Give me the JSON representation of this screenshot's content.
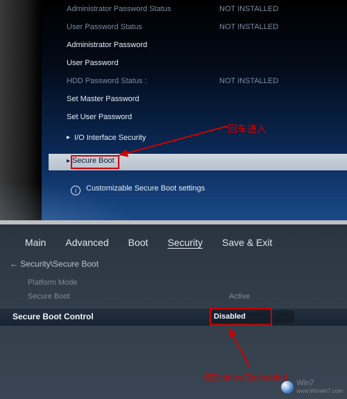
{
  "top": {
    "rows": {
      "admin_status_label": "Administrator Password Status",
      "admin_status_value": "NOT INSTALLED",
      "user_status_label": "User Password Status",
      "user_status_value": "NOT INSTALLED",
      "admin_pw": "Administrator Password",
      "user_pw": "User Password",
      "hdd_status_label": "HDD Password Status :",
      "hdd_status_value": "NOT INSTALLED",
      "set_master": "Set Master Password",
      "set_user": "Set User Password",
      "io_sec": "I/O Interface Security",
      "secure_boot": "Secure Boot"
    },
    "info_text": "Customizable Secure Boot settings",
    "annotation": "回车进入"
  },
  "bottom": {
    "tabs": {
      "main": "Main",
      "advanced": "Advanced",
      "boot": "Boot",
      "security": "Security",
      "save_exit": "Save & Exit"
    },
    "breadcrumb": "Security\\Secure Boot",
    "row1_label": "Platform Mode",
    "row2_label": "Secure Boot",
    "row2_value": "Active",
    "control_label": "Secure Boot Control",
    "control_value": "Disabled",
    "annotation": "改Enabled为disabled",
    "watermark": "Win7",
    "watermark_url": "www.Winwin7.com"
  }
}
